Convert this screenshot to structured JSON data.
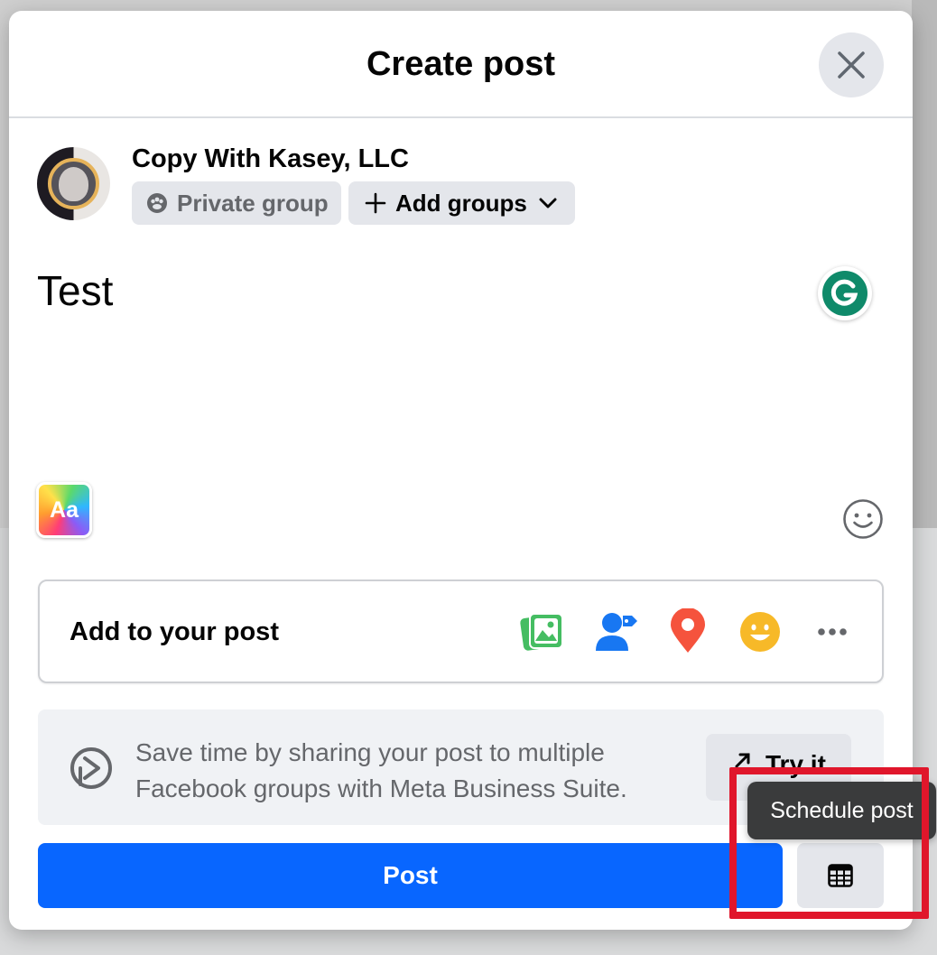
{
  "modal": {
    "title": "Create post"
  },
  "author": {
    "name": "Copy With Kasey, LLC",
    "audience_label": "Private group",
    "add_groups_label": "Add groups"
  },
  "composer": {
    "text": "Test"
  },
  "add_to_post": {
    "label": "Add to your post",
    "icons": [
      "photo-video-icon",
      "tag-people-icon",
      "check-in-icon",
      "feeling-icon",
      "more-icon"
    ]
  },
  "promo": {
    "text": "Save time by sharing your post to multiple Facebook groups with Meta Business Suite.",
    "button_label": "Try it"
  },
  "actions": {
    "post_label": "Post",
    "schedule_tooltip": "Schedule post"
  },
  "colors": {
    "primary": "#0866ff",
    "highlight": "#e0162b",
    "button_gray": "#e4e6eb"
  }
}
